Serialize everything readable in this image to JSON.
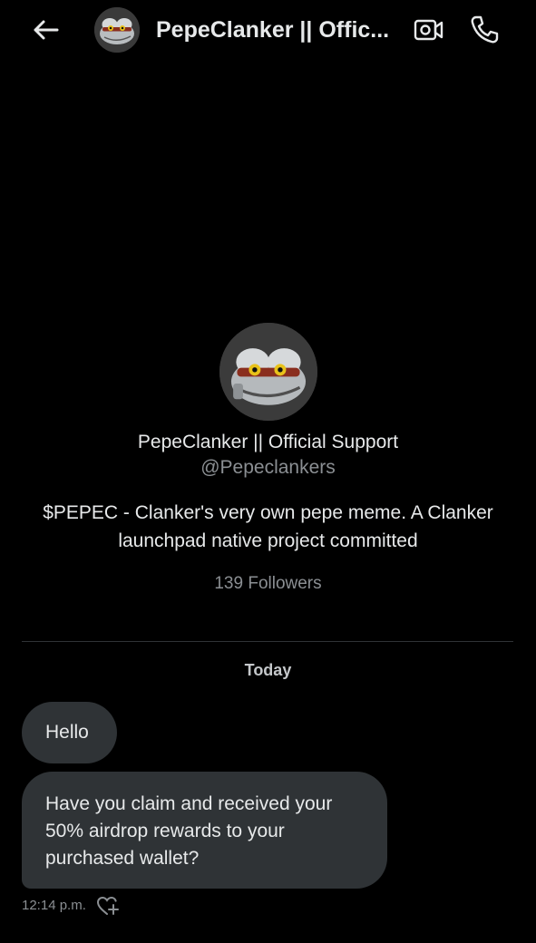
{
  "header": {
    "title": "PepeClanker || Offic...",
    "back_icon": "arrow-left-icon",
    "video_icon": "video-call-icon",
    "call_icon": "phone-call-icon"
  },
  "profile": {
    "name": "PepeClanker || Official Support",
    "handle": "@Pepeclankers",
    "bio": "$PEPEC - Clanker's very own pepe meme. A Clanker launchpad native project committed",
    "followers": "139 Followers"
  },
  "conversation": {
    "date_label": "Today",
    "messages": [
      {
        "text": "Hello"
      },
      {
        "text": "Have you claim  and received your  50% airdrop rewards to your purchased wallet?"
      }
    ],
    "timestamp": "12:14 p.m.",
    "react_icon": "heart-plus-icon"
  },
  "colors": {
    "background": "#000000",
    "bubble": "#2f3336",
    "text_primary": "#e7e9ea",
    "text_secondary": "#8b8f93"
  }
}
